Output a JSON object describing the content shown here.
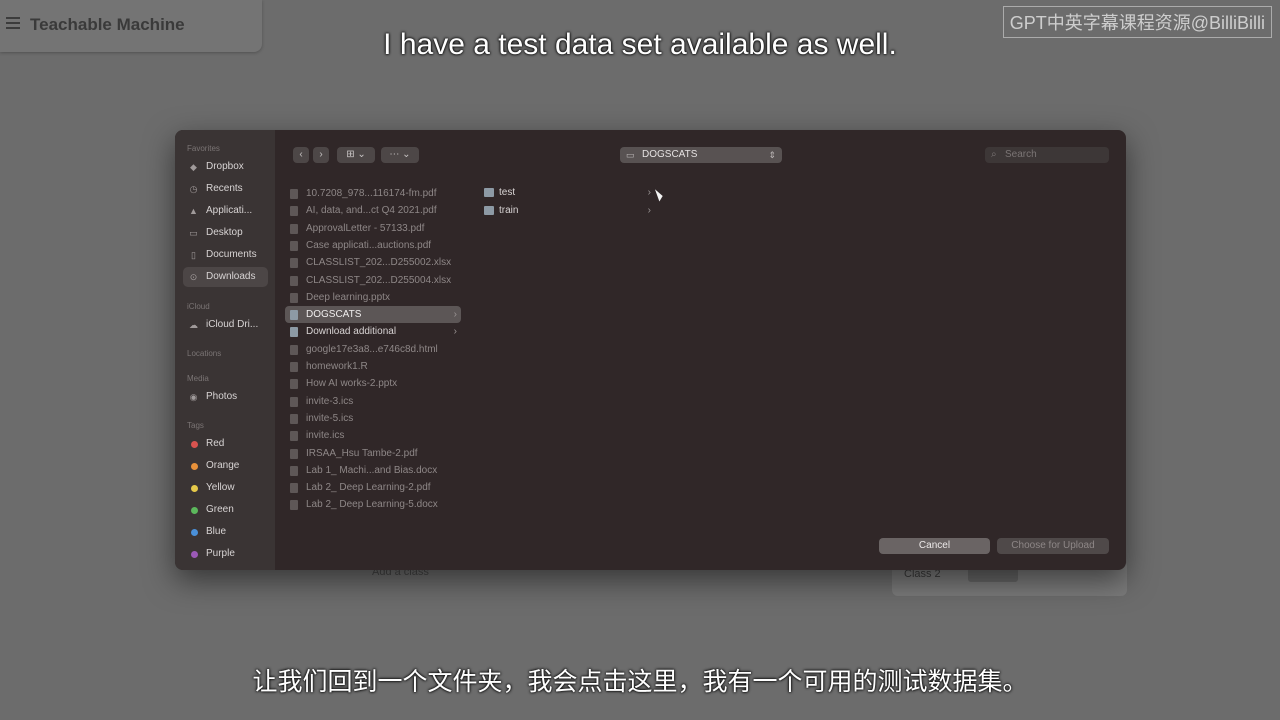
{
  "app": {
    "title": "Teachable Machine",
    "class_card_label": "Class 2",
    "class_label": "Add a class"
  },
  "subtitle": {
    "top": "I have a test data set available as well.",
    "bottom": "让我们回到一个文件夹，我会点击这里，我有一个可用的测试数据集。",
    "watermark": "GPT中英字幕课程资源@BilliBilli"
  },
  "dialog": {
    "path": "DOGSCATS",
    "search_placeholder": "Search",
    "view_icons": "⊞ ⌄",
    "group_icons": "⋯ ⌄",
    "cancel": "Cancel",
    "choose": "Choose for Upload",
    "sidebar": {
      "favorites_title": "Favorites",
      "favorites": [
        {
          "label": "Dropbox",
          "icon": "dropbox-icon"
        },
        {
          "label": "Recents",
          "icon": "clock-icon"
        },
        {
          "label": "Applicati...",
          "icon": "apps-icon"
        },
        {
          "label": "Desktop",
          "icon": "desktop-icon"
        },
        {
          "label": "Documents",
          "icon": "document-icon"
        },
        {
          "label": "Downloads",
          "icon": "download-icon"
        }
      ],
      "icloud_title": "iCloud",
      "icloud": [
        {
          "label": "iCloud Dri...",
          "icon": "cloud-icon"
        }
      ],
      "locations_title": "Locations",
      "media_title": "Media",
      "media": [
        {
          "label": "Photos",
          "icon": "photos-icon"
        }
      ],
      "tags_title": "Tags",
      "tags": [
        {
          "label": "Red",
          "color": "#d9534f"
        },
        {
          "label": "Orange",
          "color": "#e8913a"
        },
        {
          "label": "Yellow",
          "color": "#e5c94a"
        },
        {
          "label": "Green",
          "color": "#5cb85c"
        },
        {
          "label": "Blue",
          "color": "#4a90d9"
        },
        {
          "label": "Purple",
          "color": "#9b59b6"
        }
      ]
    },
    "files": [
      {
        "label": "10.7208_978...116174-fm.pdf"
      },
      {
        "label": "AI, data, and...ct Q4 2021.pdf"
      },
      {
        "label": "ApprovalLetter - 57133.pdf"
      },
      {
        "label": "Case applicati...auctions.pdf"
      },
      {
        "label": "CLASSLIST_202...D255002.xlsx"
      },
      {
        "label": "CLASSLIST_202...D255004.xlsx"
      },
      {
        "label": "Deep learning.pptx"
      },
      {
        "label": "DOGSCATS"
      },
      {
        "label": "Download additional"
      },
      {
        "label": "google17e3a8...e746c8d.html"
      },
      {
        "label": "homework1.R"
      },
      {
        "label": "How AI works-2.pptx"
      },
      {
        "label": "invite-3.ics"
      },
      {
        "label": "invite-5.ics"
      },
      {
        "label": "invite.ics"
      },
      {
        "label": "IRSAA_Hsu Tambe-2.pdf"
      },
      {
        "label": "Lab 1_ Machi...and Bias.docx"
      },
      {
        "label": "Lab 2_ Deep Learning-2.pdf"
      },
      {
        "label": "Lab 2_ Deep Learning-5.docx"
      }
    ],
    "subfolders": [
      {
        "label": "test"
      },
      {
        "label": "train"
      }
    ]
  }
}
